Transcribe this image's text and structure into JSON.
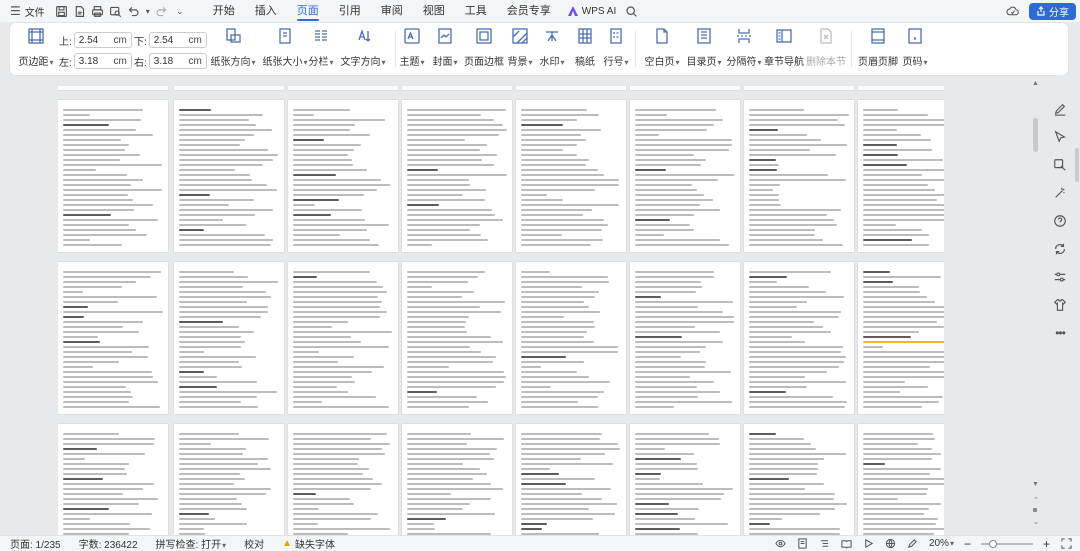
{
  "menubar": {
    "file_label": "文件",
    "tabs": [
      {
        "label": "开始",
        "active": false
      },
      {
        "label": "插入",
        "active": false
      },
      {
        "label": "页面",
        "active": true
      },
      {
        "label": "引用",
        "active": false
      },
      {
        "label": "审阅",
        "active": false
      },
      {
        "label": "视图",
        "active": false
      },
      {
        "label": "工具",
        "active": false
      },
      {
        "label": "会员专享",
        "active": false
      }
    ],
    "wps_ai": "WPS AI",
    "share_label": "分享"
  },
  "ribbon": {
    "margin_label": "页边距",
    "margins": {
      "top_label": "上:",
      "top_value": "2.54",
      "bottom_label": "下:",
      "bottom_value": "2.54",
      "left_label": "左:",
      "left_value": "3.18",
      "right_label": "右:",
      "right_value": "3.18",
      "unit": "cm"
    },
    "paper_orientation": "纸张方向",
    "paper_size": "纸张大小",
    "columns": "分栏",
    "text_direction": "文字方向",
    "theme": "主题",
    "cover": "封面",
    "page_border": "页面边框",
    "background": "背景",
    "watermark": "水印",
    "manuscript": "稿纸",
    "line_number": "行号",
    "blank_page": "空白页",
    "toc_page": "目录页",
    "separator": "分隔符",
    "section_nav": "章节导航",
    "delete_section": "删除本节",
    "header_footer": "页眉页脚",
    "page_number": "页码"
  },
  "statusbar": {
    "page": "页面: 1/235",
    "word_count": "字数: 236422",
    "spell_check": "拼写检查: 打开",
    "proofread": "校对",
    "missing_font": "缺失字体",
    "zoom": "20%"
  }
}
